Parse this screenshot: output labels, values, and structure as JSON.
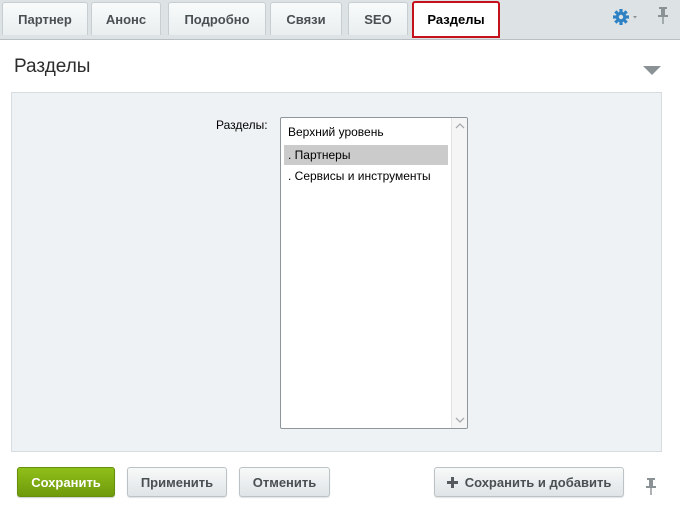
{
  "tabs": [
    {
      "label": "Партнер"
    },
    {
      "label": "Анонс"
    },
    {
      "label": "Подробно"
    },
    {
      "label": "Связи"
    },
    {
      "label": "SEO"
    },
    {
      "label": "Разделы",
      "active": true
    }
  ],
  "toolbar": {
    "settings_icon": "gear-icon",
    "pin_icon": "pin-icon"
  },
  "section": {
    "title": "Разделы",
    "collapse_icon": "triangle-down-icon"
  },
  "sections_field": {
    "label": "Разделы:",
    "options": [
      {
        "label": "Верхний уровень",
        "selected": false
      },
      {
        "label": ". Партнеры",
        "selected": true
      },
      {
        "label": ". Сервисы и инструменты",
        "selected": false
      }
    ]
  },
  "buttons": {
    "save": "Сохранить",
    "apply": "Применить",
    "cancel": "Отменить",
    "save_and_add": "Сохранить и добавить"
  },
  "colors": {
    "active_tab_outline": "#c4111c",
    "save_button": "#7aa812",
    "selected_option": "#cbcbcb",
    "panel_bg": "#eef2f4",
    "gear_icon": "#2e82c4"
  }
}
